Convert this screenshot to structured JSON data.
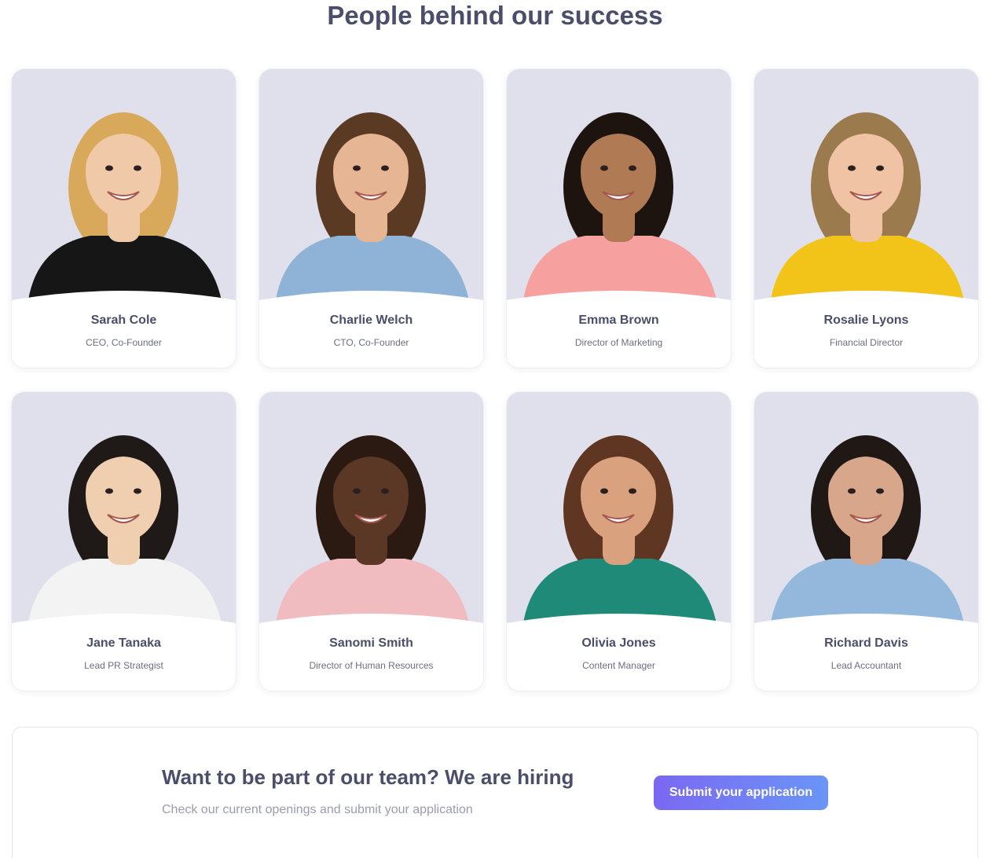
{
  "page": {
    "title": "People behind our success"
  },
  "team": [
    {
      "name": "Sarah Cole",
      "role": "CEO, Co-Founder",
      "skin": "#f0c9a8",
      "hair": "#d9a95b",
      "shirt": "#161616"
    },
    {
      "name": "Charlie Welch",
      "role": "CTO, Co-Founder",
      "skin": "#e6b694",
      "hair": "#5a3a22",
      "shirt": "#8fb3d6"
    },
    {
      "name": "Emma Brown",
      "role": "Director of Marketing",
      "skin": "#b07a55",
      "hair": "#1d1410",
      "shirt": "#f6a0a0"
    },
    {
      "name": "Rosalie Lyons",
      "role": "Financial Director",
      "skin": "#efc3a3",
      "hair": "#9b7a4e",
      "shirt": "#f2c318"
    },
    {
      "name": "Jane Tanaka",
      "role": "Lead PR Strategist",
      "skin": "#f0cfb1",
      "hair": "#1f1a17",
      "shirt": "#f3f3f3"
    },
    {
      "name": "Sanomi Smith",
      "role": "Director of Human Resources",
      "skin": "#5b3725",
      "hair": "#2a1a12",
      "shirt": "#f1bcc0"
    },
    {
      "name": "Olivia Jones",
      "role": "Content Manager",
      "skin": "#d9a17e",
      "hair": "#5e3621",
      "shirt": "#1f8a78"
    },
    {
      "name": "Richard Davis",
      "role": "Lead Accountant",
      "skin": "#d8a68a",
      "hair": "#1f1814",
      "shirt": "#93b8dc"
    }
  ],
  "hiring": {
    "title": "Want to be part of our team? We are hiring",
    "subtitle": "Check our current openings and submit your application",
    "button_label": "Submit your application"
  }
}
